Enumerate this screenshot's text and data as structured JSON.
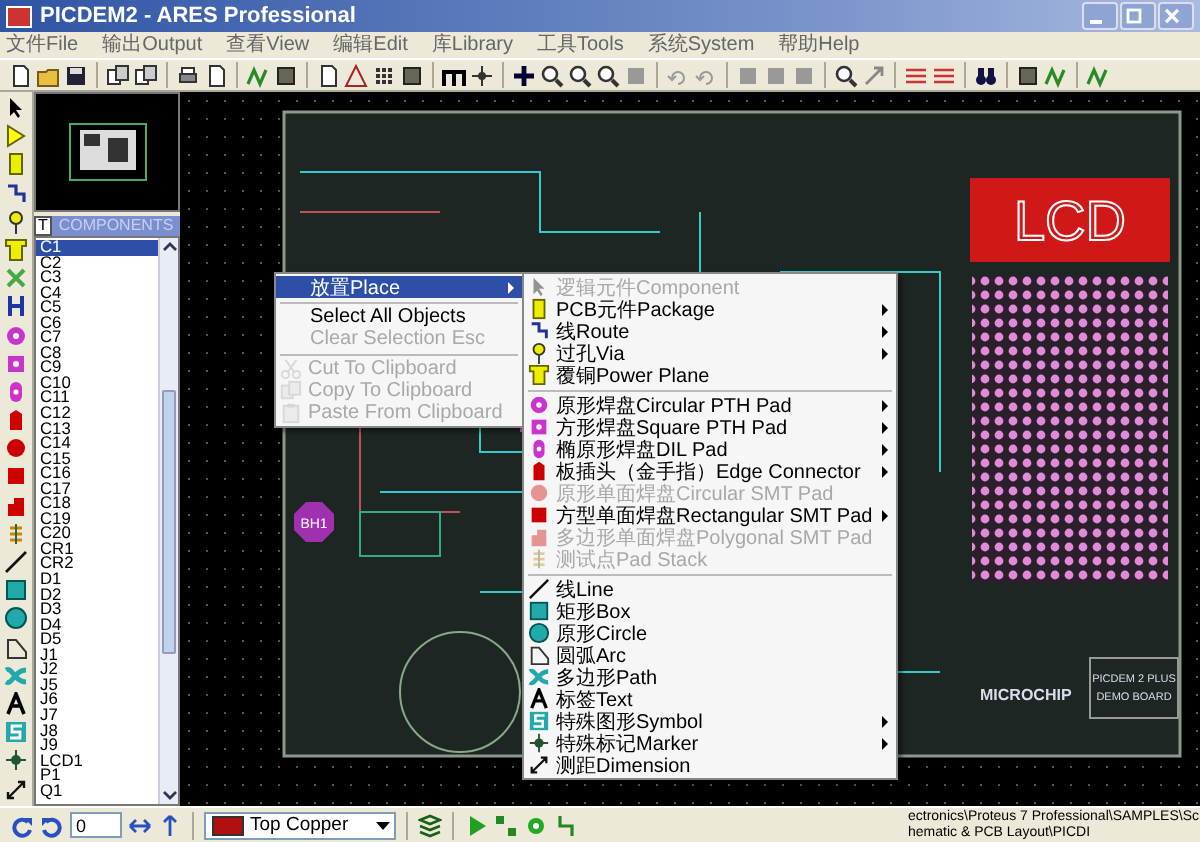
{
  "window": {
    "title": "PICDEM2 - ARES Professional"
  },
  "menu_bar": [
    "文件File",
    "输出Output",
    "查看View",
    "编辑Edit",
    "库Library",
    "工具Tools",
    "系统System",
    "帮助Help"
  ],
  "component_panel": {
    "tab_button": "T",
    "title": "COMPONENTS",
    "items": [
      {
        "label": "C1",
        "selected": true
      },
      {
        "label": "C2",
        "selected": false
      },
      {
        "label": "C3",
        "selected": false
      },
      {
        "label": "C4",
        "selected": false
      },
      {
        "label": "C5",
        "selected": false
      },
      {
        "label": "C6",
        "selected": false
      },
      {
        "label": "C7",
        "selected": false
      },
      {
        "label": "C8",
        "selected": false
      },
      {
        "label": "C9",
        "selected": false
      },
      {
        "label": "C10",
        "selected": false
      },
      {
        "label": "C11",
        "selected": false
      },
      {
        "label": "C12",
        "selected": false
      },
      {
        "label": "C13",
        "selected": false
      },
      {
        "label": "C14",
        "selected": false
      },
      {
        "label": "C15",
        "selected": false
      },
      {
        "label": "C16",
        "selected": false
      },
      {
        "label": "C17",
        "selected": false
      },
      {
        "label": "C18",
        "selected": false
      },
      {
        "label": "C19",
        "selected": false
      },
      {
        "label": "C20",
        "selected": false
      },
      {
        "label": "CR1",
        "selected": false
      },
      {
        "label": "CR2",
        "selected": false
      },
      {
        "label": "D1",
        "selected": false
      },
      {
        "label": "D2",
        "selected": false
      },
      {
        "label": "D3",
        "selected": false
      },
      {
        "label": "D4",
        "selected": false
      },
      {
        "label": "D5",
        "selected": false
      },
      {
        "label": "J1",
        "selected": false
      },
      {
        "label": "J2",
        "selected": false
      },
      {
        "label": "J5",
        "selected": false
      },
      {
        "label": "J6",
        "selected": false
      },
      {
        "label": "J7",
        "selected": false
      },
      {
        "label": "J8",
        "selected": false
      },
      {
        "label": "J9",
        "selected": false
      },
      {
        "label": "LCD1",
        "selected": false
      },
      {
        "label": "P1",
        "selected": false
      },
      {
        "label": "Q1",
        "selected": false
      }
    ]
  },
  "canvas": {
    "lcd_label": "LCD",
    "part_label": "BH1",
    "logo_text": "MICROCHIP",
    "board_title": [
      "PICDEM 2 PLUS",
      "DEMO BOARD"
    ]
  },
  "context_menu": {
    "items": [
      {
        "kind": "item",
        "label": "放置Place",
        "selected": true,
        "disabled": false,
        "submenu": true
      },
      {
        "kind": "separator"
      },
      {
        "kind": "item",
        "label": "Select All Objects",
        "selected": false,
        "disabled": false,
        "submenu": false
      },
      {
        "kind": "item",
        "label": "Clear Selection",
        "shortcut": "Esc",
        "selected": false,
        "disabled": true,
        "submenu": false
      },
      {
        "kind": "separator"
      },
      {
        "kind": "item",
        "label": "Cut To Clipboard",
        "selected": false,
        "disabled": true,
        "submenu": false
      },
      {
        "kind": "item",
        "label": "Copy To Clipboard",
        "selected": false,
        "disabled": true,
        "submenu": false
      },
      {
        "kind": "item",
        "label": "Paste From Clipboard",
        "selected": false,
        "disabled": true,
        "submenu": false
      }
    ]
  },
  "place_submenu": {
    "items": [
      {
        "kind": "item",
        "label": "逻辑元件Component",
        "disabled": true,
        "submenu": false
      },
      {
        "kind": "item",
        "label": "PCB元件Package",
        "disabled": false,
        "submenu": true
      },
      {
        "kind": "item",
        "label": "线Route",
        "disabled": false,
        "submenu": true
      },
      {
        "kind": "item",
        "label": "过孔Via",
        "disabled": false,
        "submenu": true
      },
      {
        "kind": "item",
        "label": "覆铜Power Plane",
        "disabled": false,
        "submenu": false
      },
      {
        "kind": "separator"
      },
      {
        "kind": "item",
        "label": "原形焊盘Circular PTH Pad",
        "disabled": false,
        "submenu": true
      },
      {
        "kind": "item",
        "label": "方形焊盘Square PTH Pad",
        "disabled": false,
        "submenu": true
      },
      {
        "kind": "item",
        "label": "椭原形焊盘DIL Pad",
        "disabled": false,
        "submenu": true
      },
      {
        "kind": "item",
        "label": "板插头（金手指）Edge Connector",
        "disabled": false,
        "submenu": true
      },
      {
        "kind": "item",
        "label": "原形单面焊盘Circular SMT Pad",
        "disabled": true,
        "submenu": false
      },
      {
        "kind": "item",
        "label": "方型单面焊盘Rectangular SMT Pad",
        "disabled": false,
        "submenu": true
      },
      {
        "kind": "item",
        "label": "多边形单面焊盘Polygonal SMT Pad",
        "disabled": true,
        "submenu": false
      },
      {
        "kind": "item",
        "label": "测试点Pad Stack",
        "disabled": true,
        "submenu": false
      },
      {
        "kind": "separator"
      },
      {
        "kind": "item",
        "label": "线Line",
        "disabled": false,
        "submenu": false
      },
      {
        "kind": "item",
        "label": "矩形Box",
        "disabled": false,
        "submenu": false
      },
      {
        "kind": "item",
        "label": "原形Circle",
        "disabled": false,
        "submenu": false
      },
      {
        "kind": "item",
        "label": "圆弧Arc",
        "disabled": false,
        "submenu": false
      },
      {
        "kind": "item",
        "label": "多边形Path",
        "disabled": false,
        "submenu": false
      },
      {
        "kind": "item",
        "label": "标签Text",
        "disabled": false,
        "submenu": false
      },
      {
        "kind": "item",
        "label": "特殊图形Symbol",
        "disabled": false,
        "submenu": true
      },
      {
        "kind": "item",
        "label": "特殊标记Marker",
        "disabled": false,
        "submenu": true
      },
      {
        "kind": "item",
        "label": "测距Dimension",
        "disabled": false,
        "submenu": false
      }
    ]
  },
  "status_bar": {
    "angle": "0",
    "layer": "Top Copper",
    "path": "ectronics\\Proteus 7 Professional\\SAMPLES\\Schematic & PCB Layout\\PICDI"
  }
}
